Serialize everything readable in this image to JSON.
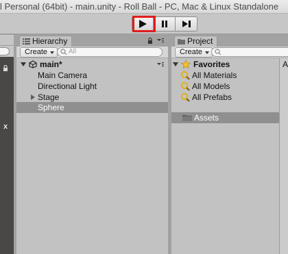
{
  "window": {
    "title": "l Personal (64bit) - main.unity - Roll Ball - PC, Mac & Linux Standalone"
  },
  "toolbar": {
    "play_icon": "play-icon",
    "pause_icon": "pause-icon",
    "step_icon": "step-icon",
    "highlight_color": "#e01c1c"
  },
  "hierarchy": {
    "tab_label": "Hierarchy",
    "create_label": "Create",
    "search_placeholder": "All",
    "scene_name": "main*",
    "items": [
      {
        "label": "Main Camera",
        "selected": false
      },
      {
        "label": "Directional Light",
        "selected": false
      },
      {
        "label": "Stage",
        "selected": false,
        "has_children": true
      },
      {
        "label": "Sphere",
        "selected": true
      }
    ]
  },
  "project": {
    "tab_label": "Project",
    "create_label": "Create",
    "favorites_label": "Favorites",
    "favorites": [
      {
        "label": "All Materials"
      },
      {
        "label": "All Models"
      },
      {
        "label": "All Prefabs"
      }
    ],
    "assets_label": "Assets",
    "right_column_label": "A"
  },
  "left_panel": {
    "close_label": "x"
  },
  "colors": {
    "selection": "#8f8f8f",
    "panel": "#c2c2c2"
  }
}
